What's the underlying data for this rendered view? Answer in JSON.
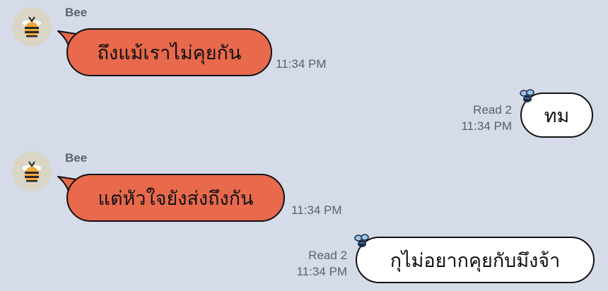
{
  "colors": {
    "background": "#d5dbe8",
    "incoming_bubble": "#e8694c",
    "outgoing_bubble": "#ffffff",
    "meta_text": "#5c606c"
  },
  "messages": [
    {
      "direction": "incoming",
      "sender": "Bee",
      "avatar_icon": "bee-icon",
      "text": "ถึงแม้เราไม่คุยกัน",
      "time": "11:34 PM"
    },
    {
      "direction": "outgoing",
      "read": "Read 2",
      "time": "11:34 PM",
      "text": "ทม"
    },
    {
      "direction": "incoming",
      "sender": "Bee",
      "avatar_icon": "bee-icon",
      "text": "แต่หัวใจยังส่งถึงกัน",
      "time": "11:34 PM"
    },
    {
      "direction": "outgoing",
      "read": "Read 2",
      "time": "11:34 PM",
      "text": "กุไม่อยากคุยกับมึงจ้า"
    }
  ]
}
